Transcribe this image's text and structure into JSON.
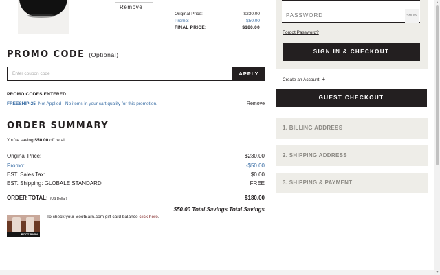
{
  "cart_item": {
    "remove_label": "Remove"
  },
  "mini_summary": {
    "rows": [
      {
        "label": "Original Price:",
        "value": "$230.00"
      },
      {
        "label": "Promo:",
        "value": "-$50.00"
      },
      {
        "label": "FINAL PRICE:",
        "value": "$180.00"
      }
    ]
  },
  "promo": {
    "title": "PROMO CODE",
    "optional": "(Optional)",
    "placeholder": "Enter coupon code",
    "apply_label": "APPLY",
    "entered_title": "PROMO CODES ENTERED",
    "entered": {
      "code": "FREESHIP-25",
      "note": "Not Applied - No items in your cart qualify for this promotion.",
      "remove_label": "Remove"
    }
  },
  "order_summary": {
    "title": "ORDER SUMMARY",
    "saving_prefix": "You're saving ",
    "saving_amount": "$50.00",
    "saving_suffix": " off retail.",
    "rows": [
      {
        "label": "Original Price:",
        "value": "$230.00"
      },
      {
        "label": "Promo:",
        "value": "-$50.00"
      },
      {
        "label": "EST. Sales Tax:",
        "value": "$0.00"
      },
      {
        "label": "EST. Shipping: GLOBALE STANDARD",
        "value": "FREE"
      }
    ],
    "total_label": "ORDER TOTAL:",
    "total_currency": "(US Dollar)",
    "total_value": "$180.00",
    "savings_line": "$50.00 Total Savings Total Savings"
  },
  "gift_card": {
    "text": "To check your BootBarn.com gift card balance ",
    "link": "click here",
    "suffix": ".",
    "logo_text": "BOOT BARN"
  },
  "login": {
    "password_label": "PASSWORD",
    "show_label": "SHOW",
    "forgot_label": "Forgot Password?",
    "signin_label": "SIGN IN & CHECKOUT"
  },
  "guest": {
    "create_account": "Create an Account",
    "plus": "+",
    "guest_label": "GUEST CHECKOUT"
  },
  "steps": [
    {
      "label": "1. BILLING ADDRESS"
    },
    {
      "label": "2. SHIPPING ADDRESS"
    },
    {
      "label": "3. SHIPPING & PAYMENT"
    }
  ],
  "colors": {
    "dark": "#231f20",
    "promo_blue": "#3a6ea5",
    "panel": "#eeede8",
    "link_red": "#7a1b1b"
  }
}
